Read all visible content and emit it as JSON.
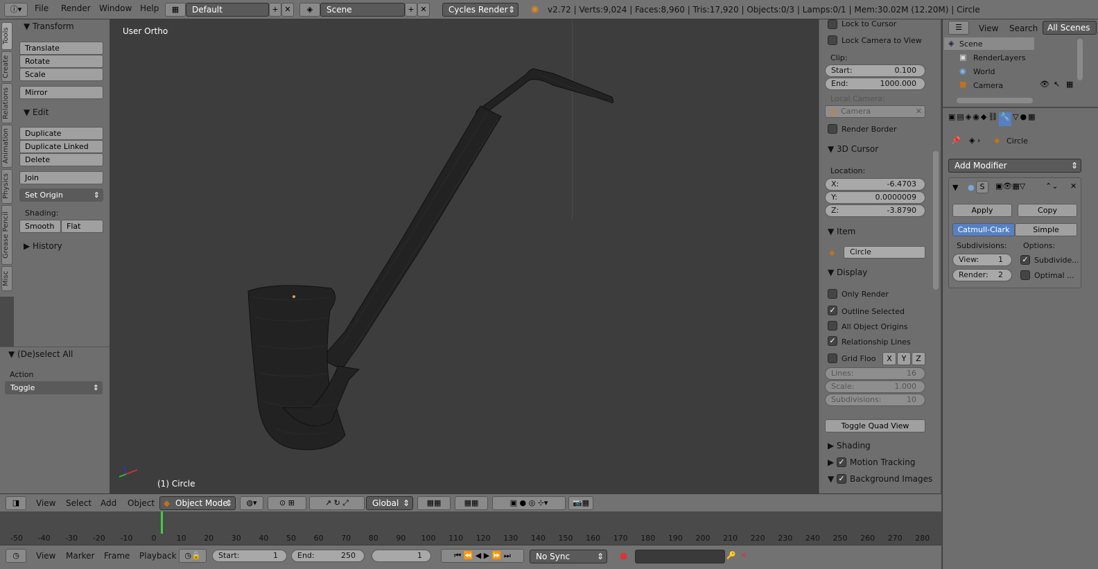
{
  "topbar": {
    "menus": [
      "File",
      "Render",
      "Window",
      "Help"
    ],
    "layout": "Default",
    "scene": "Scene",
    "engine": "Cycles Render",
    "stats": "v2.72 | Verts:9,024 | Faces:8,960 | Tris:17,920 | Objects:0/3 | Lamps:0/1 | Mem:30.02M (12.20M) | Circle"
  },
  "tabs": [
    "Tools",
    "Create",
    "Relations",
    "Animation",
    "Physics",
    "Grease Pencil",
    "Misc"
  ],
  "toolshelf": {
    "transform_header": "Transform",
    "translate": "Translate",
    "rotate": "Rotate",
    "scale": "Scale",
    "mirror": "Mirror",
    "edit_header": "Edit",
    "duplicate": "Duplicate",
    "duplicate_linked": "Duplicate Linked",
    "delete": "Delete",
    "join": "Join",
    "set_origin": "Set Origin",
    "shading_label": "Shading:",
    "smooth": "Smooth",
    "flat": "Flat",
    "history_header": "History"
  },
  "operator": {
    "header": "(De)select All",
    "action_label": "Action",
    "action_value": "Toggle"
  },
  "viewport": {
    "view_name": "User Ortho",
    "object_label": "(1) Circle"
  },
  "npanel": {
    "lock_to_cursor": "Lock to Cursor",
    "lock_camera": "Lock Camera to View",
    "clip_label": "Clip:",
    "clip_start_label": "Start:",
    "clip_start": "0.100",
    "clip_end_label": "End:",
    "clip_end": "1000.000",
    "local_camera_label": "Local Camera:",
    "local_camera": "Camera",
    "render_border": "Render Border",
    "cursor_header": "3D Cursor",
    "location_label": "Location:",
    "x_label": "X:",
    "x": "-6.4703",
    "y_label": "Y:",
    "y": "0.0000009",
    "z_label": "Z:",
    "z": "-3.8790",
    "item_header": "Item",
    "item_name": "Circle",
    "display_header": "Display",
    "only_render": "Only Render",
    "outline_selected": "Outline Selected",
    "all_origins": "All Object Origins",
    "relationship_lines": "Relationship Lines",
    "grid_floor": "Grid Floo",
    "axis_x": "X",
    "axis_y": "Y",
    "axis_z": "Z",
    "lines_label": "Lines:",
    "lines": "16",
    "scale_label": "Scale:",
    "scale": "1.000",
    "subdiv_label": "Subdivisions:",
    "subdiv": "10",
    "toggle_quad": "Toggle Quad View",
    "shading_header": "Shading",
    "motion_tracking": "Motion Tracking",
    "background_images": "Background Images"
  },
  "outliner": {
    "view": "View",
    "search": "Search",
    "all_scenes": "All Scenes",
    "items": [
      "Scene",
      "RenderLayers",
      "World",
      "Camera"
    ]
  },
  "properties": {
    "object_name": "Circle",
    "add_modifier": "Add Modifier",
    "apply": "Apply",
    "copy": "Copy",
    "catmull": "Catmull-Clark",
    "simple": "Simple",
    "subdivisions_label": "Subdivisions:",
    "options_label": "Options:",
    "view_label": "View:",
    "view_value": "1",
    "render_label": "Render:",
    "render_value": "2",
    "subdivide_uvs": "Subdivide...",
    "optimal": "Optimal ..."
  },
  "vphdr": {
    "menus": [
      "View",
      "Select",
      "Add",
      "Object"
    ],
    "mode": "Object Mode",
    "orientation": "Global"
  },
  "timeline": {
    "ticks": [
      "-50",
      "-40",
      "-30",
      "-20",
      "-10",
      "0",
      "10",
      "20",
      "30",
      "40",
      "50",
      "60",
      "70",
      "80",
      "90",
      "100",
      "110",
      "120",
      "130",
      "140",
      "150",
      "160",
      "170",
      "180",
      "190",
      "200",
      "210",
      "220",
      "230",
      "240",
      "250",
      "260",
      "270",
      "280"
    ]
  },
  "tlhdr": {
    "menus": [
      "View",
      "Marker",
      "Frame",
      "Playback"
    ],
    "start_label": "Start:",
    "start": "1",
    "end_label": "End:",
    "end": "250",
    "current": "1",
    "sync": "No Sync"
  },
  "colors": {
    "accent": "#5680c2",
    "viewport_bg": "#3d3d3d",
    "panel_bg": "#6e6e6e",
    "frame_marker": "#44cc44"
  }
}
